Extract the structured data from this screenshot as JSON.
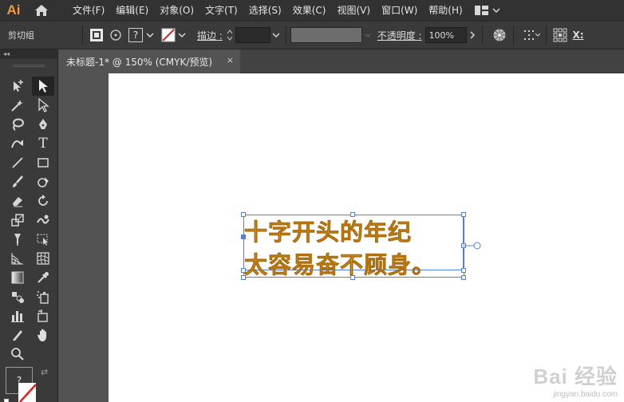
{
  "app": {
    "logo": "Ai"
  },
  "menu": [
    "文件(F)",
    "编辑(E)",
    "对象(O)",
    "文字(T)",
    "选择(S)",
    "效果(C)",
    "视图(V)",
    "窗口(W)",
    "帮助(H)"
  ],
  "control": {
    "selection_label": "剪切组",
    "fill_question": "?",
    "stroke_label": "描边 :",
    "opacity_label": "不透明度 :",
    "opacity_value": "100%",
    "x_label": "X:"
  },
  "tab": {
    "title": "未标题-1* @ 150% (CMYK/预览)",
    "close": "×"
  },
  "tools_header": "◂◂",
  "fill_question": "?",
  "canvas_text": [
    "十字开头的年纪",
    "太容易奋不顾身。"
  ],
  "watermark": {
    "main": "Bai 经验",
    "sub": "jingyan.baidu.com"
  },
  "colors": {
    "text": "#e09a22",
    "selection": "#4f7fe0",
    "logo": "#f29b37"
  }
}
